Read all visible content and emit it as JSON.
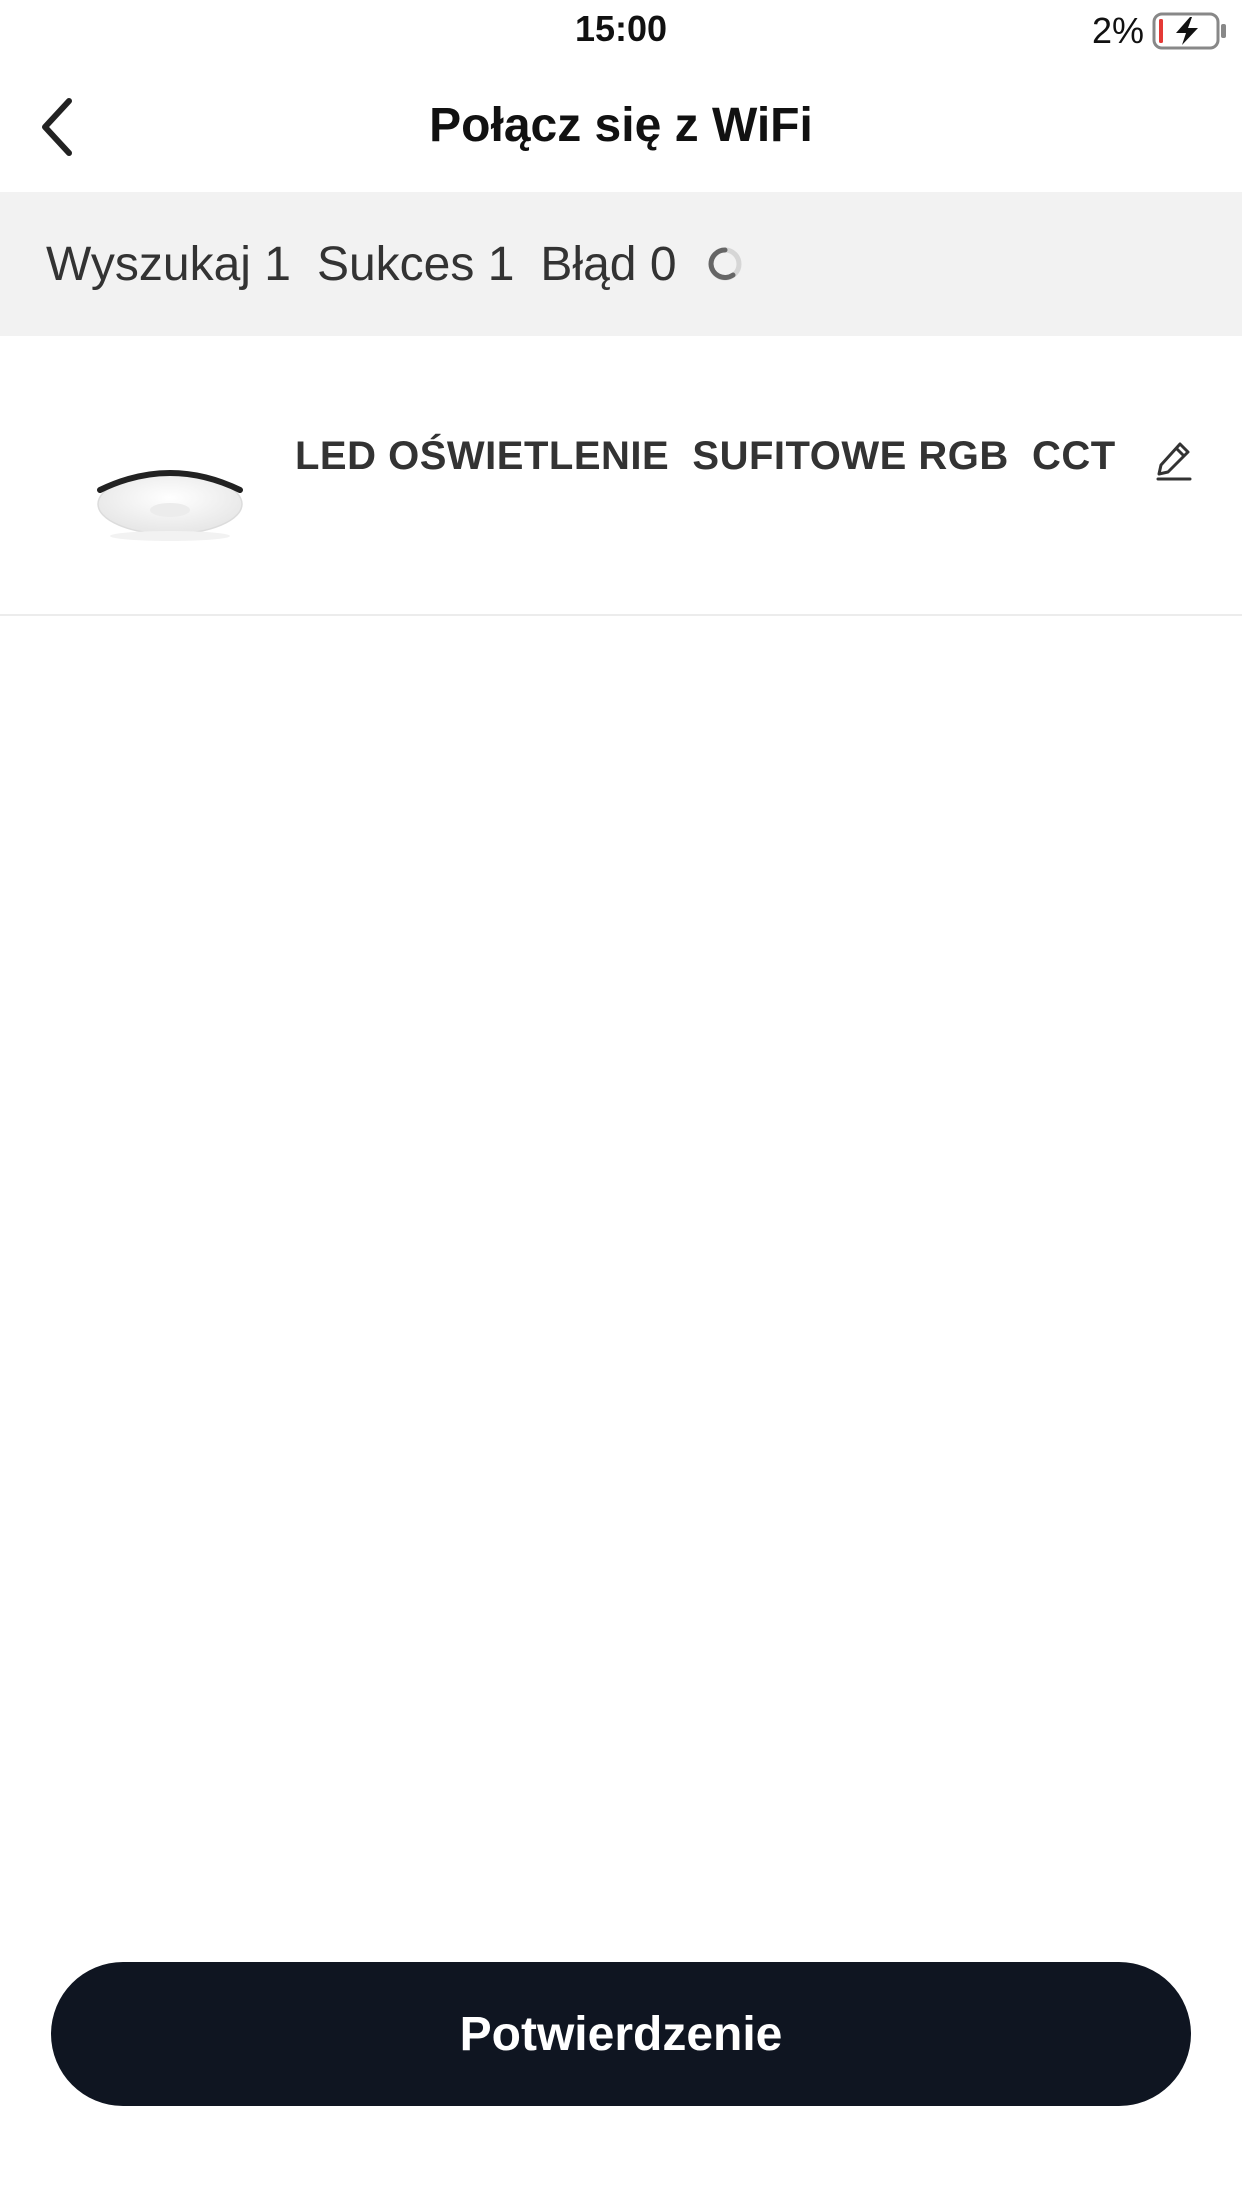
{
  "status_bar": {
    "time": "15:00",
    "battery_percent": "2%",
    "battery_icon": "battery-charging-icon",
    "battery_level": 0.02
  },
  "nav": {
    "title": "Połącz się z WiFi",
    "back_icon": "chevron-left-icon"
  },
  "summary": {
    "search_label": "Wyszukaj 1",
    "success_label": "Sukces 1",
    "error_label": "Błąd 0",
    "spinner_icon": "loading-spinner-icon"
  },
  "device": {
    "name": "LED OŚWIETLENIE  SUFITOWE RGB  CCT",
    "image_icon": "ceiling-lamp-image",
    "edit_icon": "pencil-icon"
  },
  "actions": {
    "confirm_label": "Potwierdzenie",
    "confirm_color": "#0f1521"
  },
  "colors": {
    "summary_background": "#f2f2f2",
    "battery_low": "#e53935"
  }
}
